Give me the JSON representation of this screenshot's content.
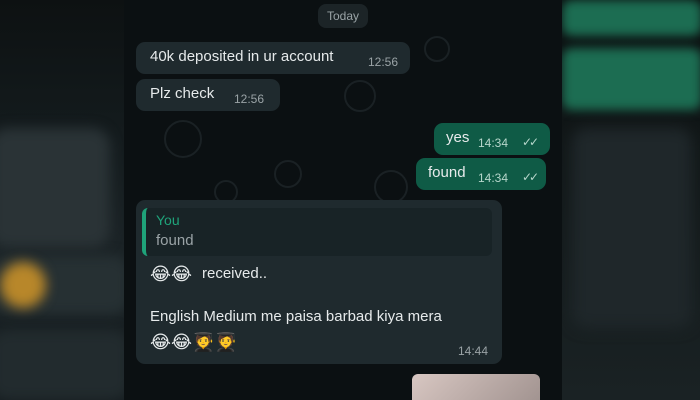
{
  "date_separator": "Today",
  "messages": [
    {
      "direction": "incoming",
      "text": "40k deposited in ur account",
      "time": "12:56"
    },
    {
      "direction": "incoming",
      "text": "Plz check",
      "time": "12:56"
    },
    {
      "direction": "outgoing",
      "text": "yes",
      "time": "14:34",
      "status": "read"
    },
    {
      "direction": "outgoing",
      "text": "found",
      "time": "14:34",
      "status": "read"
    },
    {
      "direction": "incoming",
      "quote": {
        "author": "You",
        "text": "found"
      },
      "line1_emojis": "😂😂",
      "line1_text": "received..",
      "line2_text": "English Medium me paisa barbad kiya mera",
      "line3_emojis": "😂😂🧑‍🎓🧑‍🎓",
      "time": "14:44"
    }
  ],
  "colors": {
    "incoming_bubble": "#1f2a2e",
    "outgoing_bubble": "#0f5b46",
    "quote_accent": "#1fa37a",
    "chat_background": "#0b1012"
  }
}
